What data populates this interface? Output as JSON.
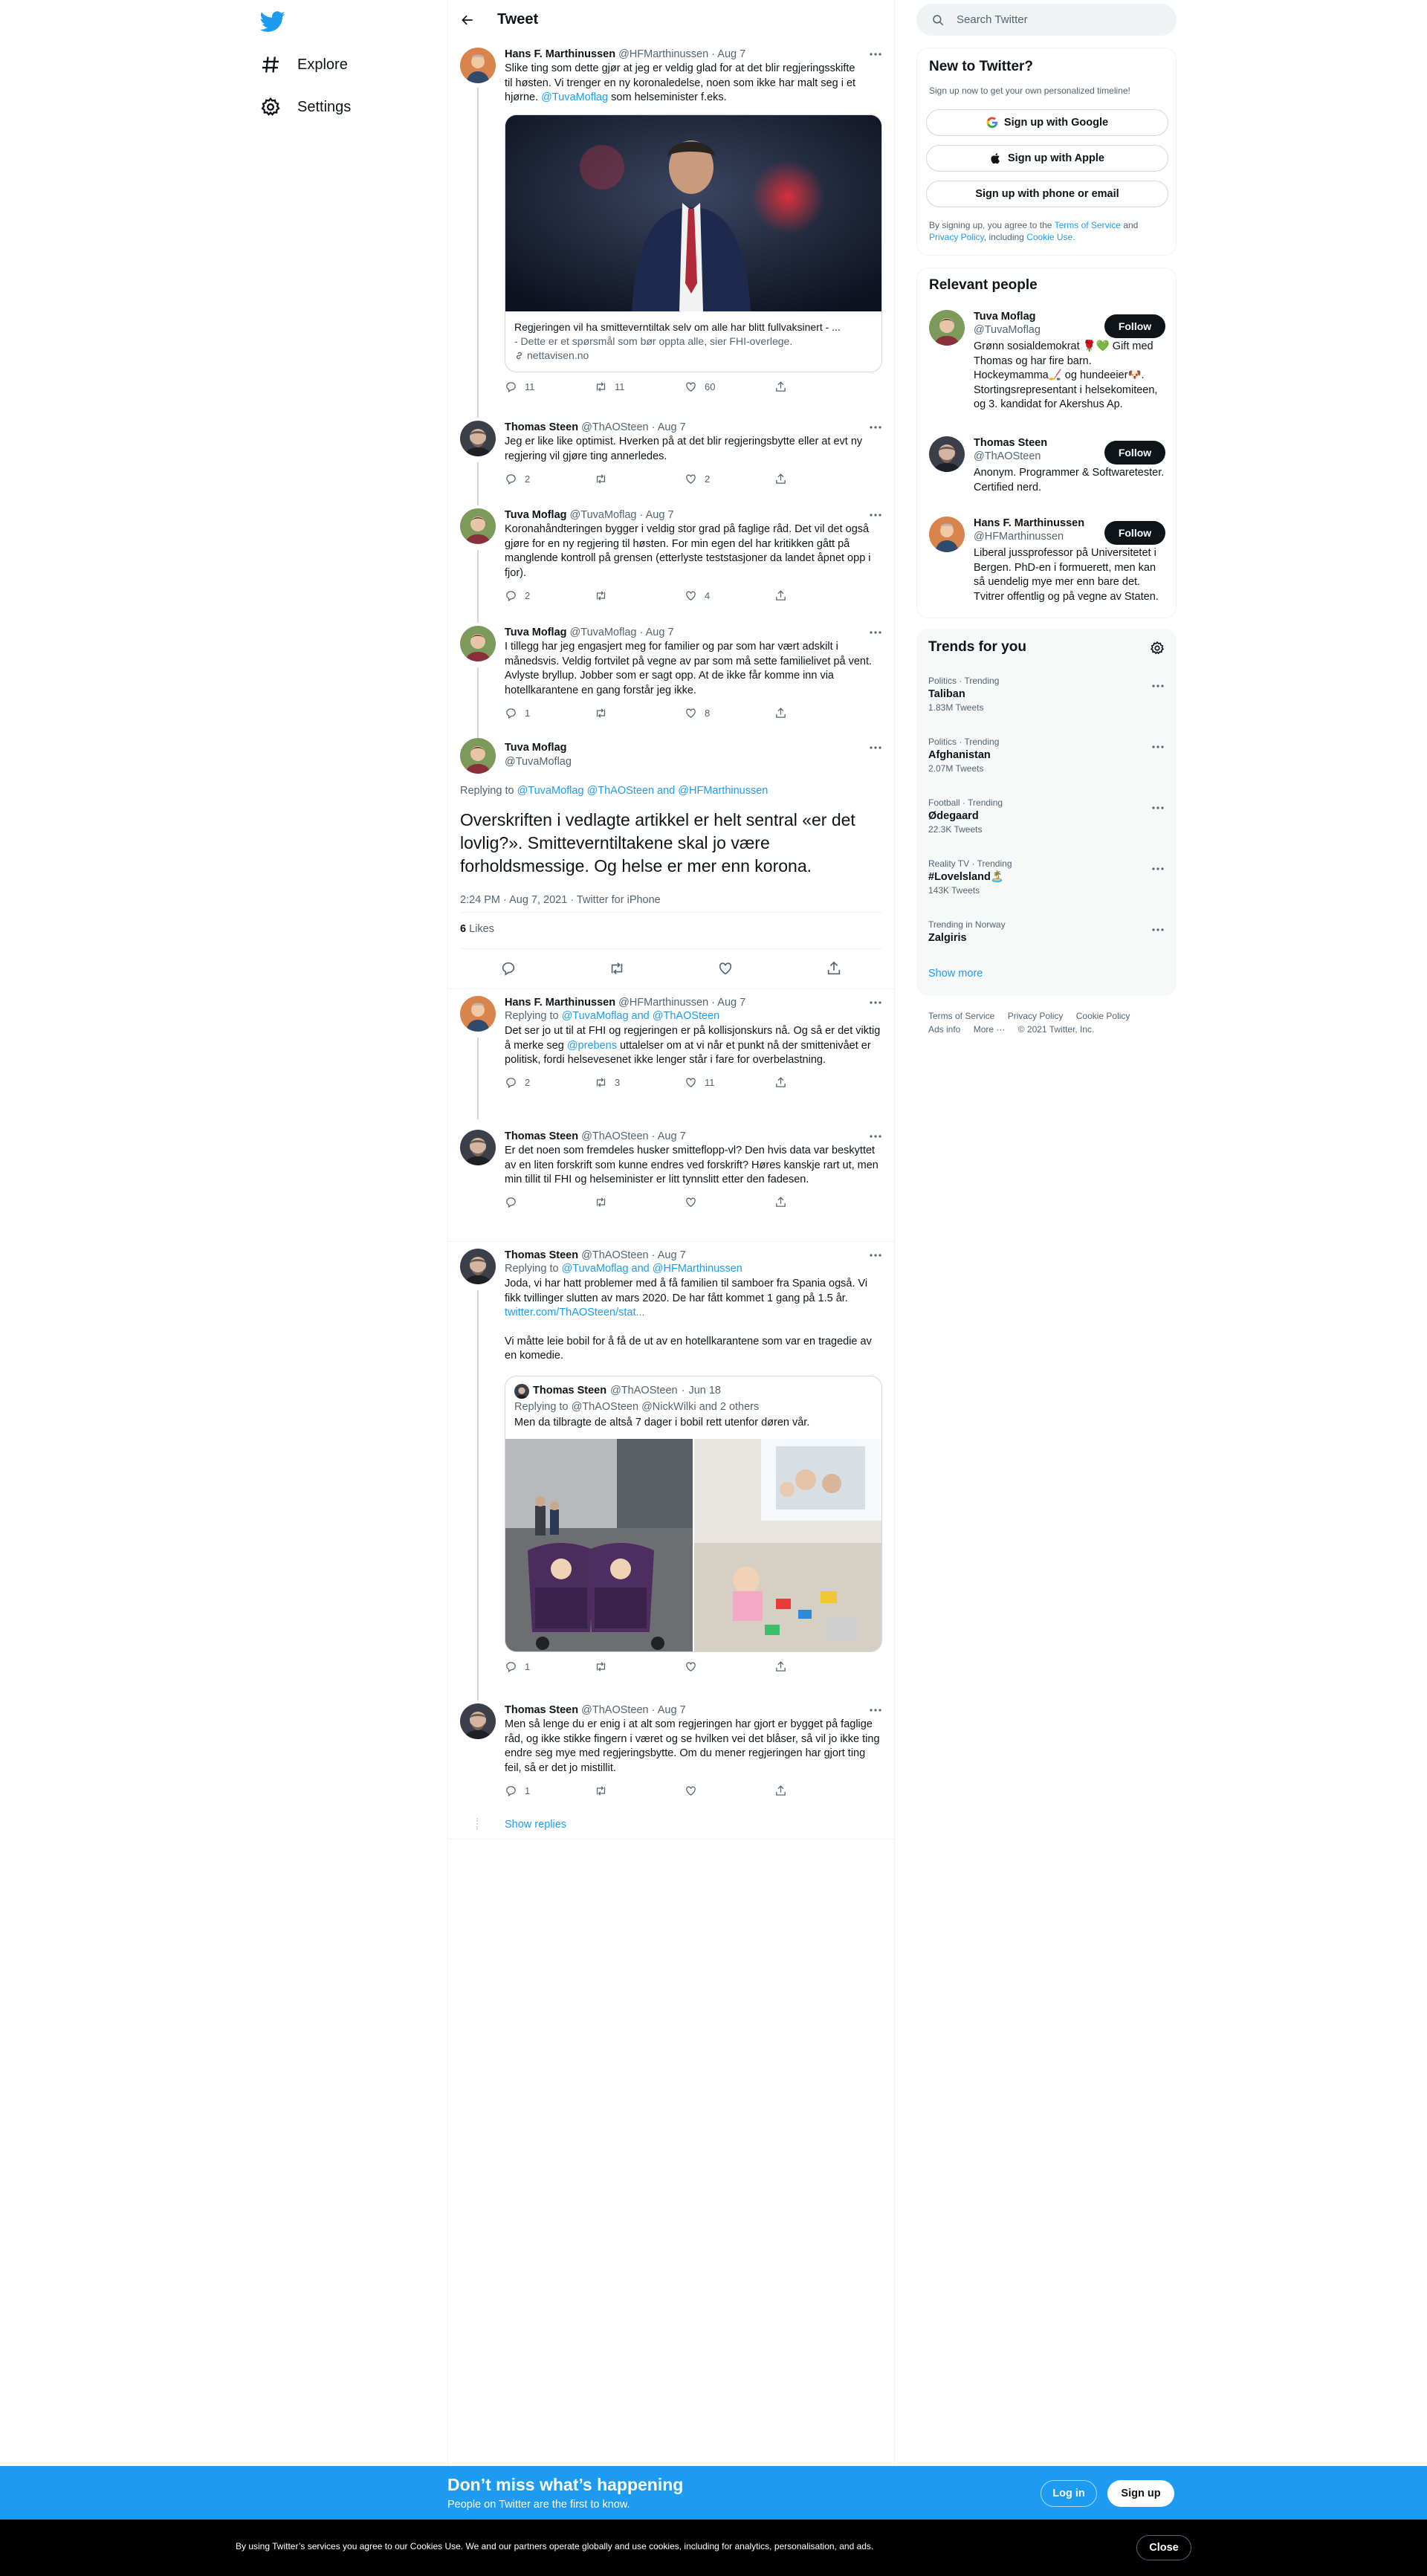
{
  "nav": {
    "explore": "Explore",
    "settings": "Settings"
  },
  "header": {
    "title": "Tweet"
  },
  "tweets": [
    {
      "name": "Hans F. Marthinussen",
      "handle": "@HFMarthinussen",
      "date": "Aug 7",
      "text_lines": [
        "Slike ting som dette gjør at jeg er veldig glad for at det blir regjeringsskifte",
        "til høsten. Vi trenger en ny koronaledelse, noen som ikke har malt seg i et",
        "hjørne."
      ],
      "mention": "@TuvaMoflag",
      "text_after": "som helseminister f.eks.",
      "card": {
        "title": "Regjeringen vil ha smitteverntiltak selv om alle har blitt fullvaksinert - ...",
        "desc": "- Dette er et spørsmål som bør oppta alle, sier FHI-overlege.",
        "domain": "nettavisen.no"
      },
      "replies": "11",
      "retweets": "11",
      "likes": "60"
    },
    {
      "name": "Thomas Steen",
      "handle": "@ThAOSteen",
      "date": "Aug 7",
      "text": "Jeg er like like optimist. Hverken på at det blir regjeringsbytte eller at evt ny regjering vil gjøre ting annerledes.",
      "replies": "2",
      "retweets": "",
      "likes": "2"
    },
    {
      "name": "Tuva Moflag",
      "handle": "@TuvaMoflag",
      "date": "Aug 7",
      "text": "Koronahåndteringen bygger i veldig stor grad på faglige råd. Det vil det også gjøre for en ny regjering til høsten. For min egen del har kritikken gått på manglende kontroll på grensen (etterlyste teststasjoner da landet åpnet opp i fjor).",
      "replies": "2",
      "retweets": "",
      "likes": "4"
    },
    {
      "name": "Tuva Moflag",
      "handle": "@TuvaMoflag",
      "date": "Aug 7",
      "text": "I tillegg har jeg engasjert meg for familier og par som har vært adskilt i månedsvis. Veldig fortvilet på vegne av par som må sette familielivet på vent. Avlyste bryllup. Jobber som er sagt opp. At de ikke får komme inn via hotellkarantene en gang forstår jeg ikke.",
      "replies": "1",
      "retweets": "",
      "likes": "8"
    }
  ],
  "focus": {
    "name": "Tuva Moflag",
    "handle": "@TuvaMoflag",
    "replying_prefix": "Replying to",
    "replying_to": "@TuvaMoflag @ThAOSteen and @HFMarthinussen",
    "text": "Overskriften i vedlagte artikkel er helt sentral «er det lovlig?». Smitteverntiltakene skal jo være forholdsmessige. Og helse er mer enn korona.",
    "meta": "2:24 PM · Aug 7, 2021 · Twitter for iPhone",
    "likes_count": "6",
    "likes_label": "Likes"
  },
  "replies": [
    {
      "name": "Hans F. Marthinussen",
      "handle": "@HFMarthinussen",
      "date": "Aug 7",
      "replying_prefix": "Replying to",
      "replying_to": "@TuvaMoflag and @ThAOSteen",
      "text_before": "Det ser jo ut til at FHI og regjeringen er på kollisjonskurs nå. Og så er det viktig å merke seg",
      "mention": "@prebens",
      "text_after": "uttalelser om at vi når et punkt nå der smittenivået er politisk, fordi helsevesenet ikke lenger står i fare for overbelastning.",
      "replies": "2",
      "retweets": "3",
      "likes": "11"
    },
    {
      "name": "Thomas Steen",
      "handle": "@ThAOSteen",
      "date": "Aug 7",
      "text": "Er det noen som fremdeles husker smitteflopp-vl? Den hvis data var beskyttet av en liten forskrift som kunne endres ved forskrift? Høres kanskje rart ut, men min tillit til FHI og helseminister er litt tynnslitt etter den fadesen.",
      "replies": "",
      "retweets": "",
      "likes": ""
    },
    {
      "name": "Thomas Steen",
      "handle": "@ThAOSteen",
      "date": "Aug 7",
      "replying_prefix": "Replying to",
      "replying_to": "@TuvaMoflag and @HFMarthinussen",
      "text": "Joda, vi har hatt problemer med å få familien til samboer fra Spania også. Vi fikk tvillinger slutten av mars 2020. De har fått kommet 1 gang på 1.5 år.",
      "link": "twitter.com/ThAOSteen/stat...",
      "text2": "Vi måtte leie bobil for å få de ut av en hotellkarantene som var en tragedie av en komedie.",
      "quote": {
        "name": "Thomas Steen",
        "handle": "@ThAOSteen",
        "date": "Jun 18",
        "replying_prefix": "Replying to",
        "replying_to": "@ThAOSteen @NickWilki and 2 others",
        "text": "Men da tilbragte de altså 7 dager i bobil rett utenfor døren vår."
      },
      "replies": "1",
      "retweets": "",
      "likes": ""
    },
    {
      "name": "Thomas Steen",
      "handle": "@ThAOSteen",
      "date": "Aug 7",
      "text": "Men så lenge du er enig i at alt som regjeringen har gjort er bygget på faglige råd, og ikke stikke fingern i været og se hvilken vei det blåser, så vil jo ikke ting endre seg mye med regjeringsbytte. Om du mener regjeringen har gjort ting feil, så er det jo mistillit.",
      "replies": "1",
      "retweets": "",
      "likes": ""
    }
  ],
  "show_replies": "Show replies",
  "search": {
    "placeholder": "Search Twitter"
  },
  "signup_box": {
    "title": "New to Twitter?",
    "subtitle": "Sign up now to get your own personalized timeline!",
    "google": "Sign up with Google",
    "apple": "Sign up with Apple",
    "phone": "Sign up with phone or email",
    "legal_1": "By signing up, you agree to the",
    "tos": "Terms of Service",
    "and": "and",
    "privacy": "Privacy Policy",
    "including": ", including",
    "cookie": "Cookie Use."
  },
  "relevant": {
    "title": "Relevant people",
    "follow_label": "Follow",
    "people": [
      {
        "name": "Tuva Moflag",
        "handle": "@TuvaMoflag",
        "bio": "Grønn sosialdemokrat 🌹💚 Gift med Thomas og har fire barn. Hockeymamma🏒 og hundeeier🐶. Stortingsrepresentant i helsekomiteen, og 3. kandidat for Akershus Ap."
      },
      {
        "name": "Thomas Steen",
        "handle": "@ThAOSteen",
        "bio": "Anonym. Programmer & Softwaretester. Certified nerd."
      },
      {
        "name": "Hans F. Marthinussen",
        "handle": "@HFMarthinussen",
        "bio": "Liberal jussprofessor på Universitetet i Bergen. PhD-en i formuerett, men kan så uendelig mye mer enn bare det. Tvitrer offentlig og på vegne av Staten."
      }
    ]
  },
  "trends": {
    "title": "Trends for you",
    "items": [
      {
        "category": "Politics · Trending",
        "name": "Taliban",
        "count": "1.83M Tweets"
      },
      {
        "category": "Politics · Trending",
        "name": "Afghanistan",
        "count": "2.07M Tweets"
      },
      {
        "category": "Football · Trending",
        "name": "Ødegaard",
        "count": "22.3K Tweets"
      },
      {
        "category": "Reality TV · Trending",
        "name": "#Lovelsland🏝️",
        "count": "143K Tweets"
      },
      {
        "category": "Trending in Norway",
        "name": "Zalgiris",
        "count": ""
      }
    ],
    "show_more": "Show more"
  },
  "footer": {
    "tos": "Terms of Service",
    "privacy": "Privacy Policy",
    "cookie": "Cookie Policy",
    "ads": "Ads info",
    "more": "More ···",
    "copyright": "© 2021 Twitter, Inc."
  },
  "bottom_bar": {
    "title": "Don’t miss what’s happening",
    "subtitle": "People on Twitter are the first to know.",
    "login": "Log in",
    "signup": "Sign up"
  },
  "cookie_bar": {
    "text": "By using Twitter’s services you agree to our Cookies Use. We and our partners operate globally and use cookies, including for analytics, personalisation, and ads.",
    "close": "Close"
  },
  "colors": {
    "accent": "#1d9bf0",
    "text": "#0f1419",
    "muted": "#536471"
  }
}
